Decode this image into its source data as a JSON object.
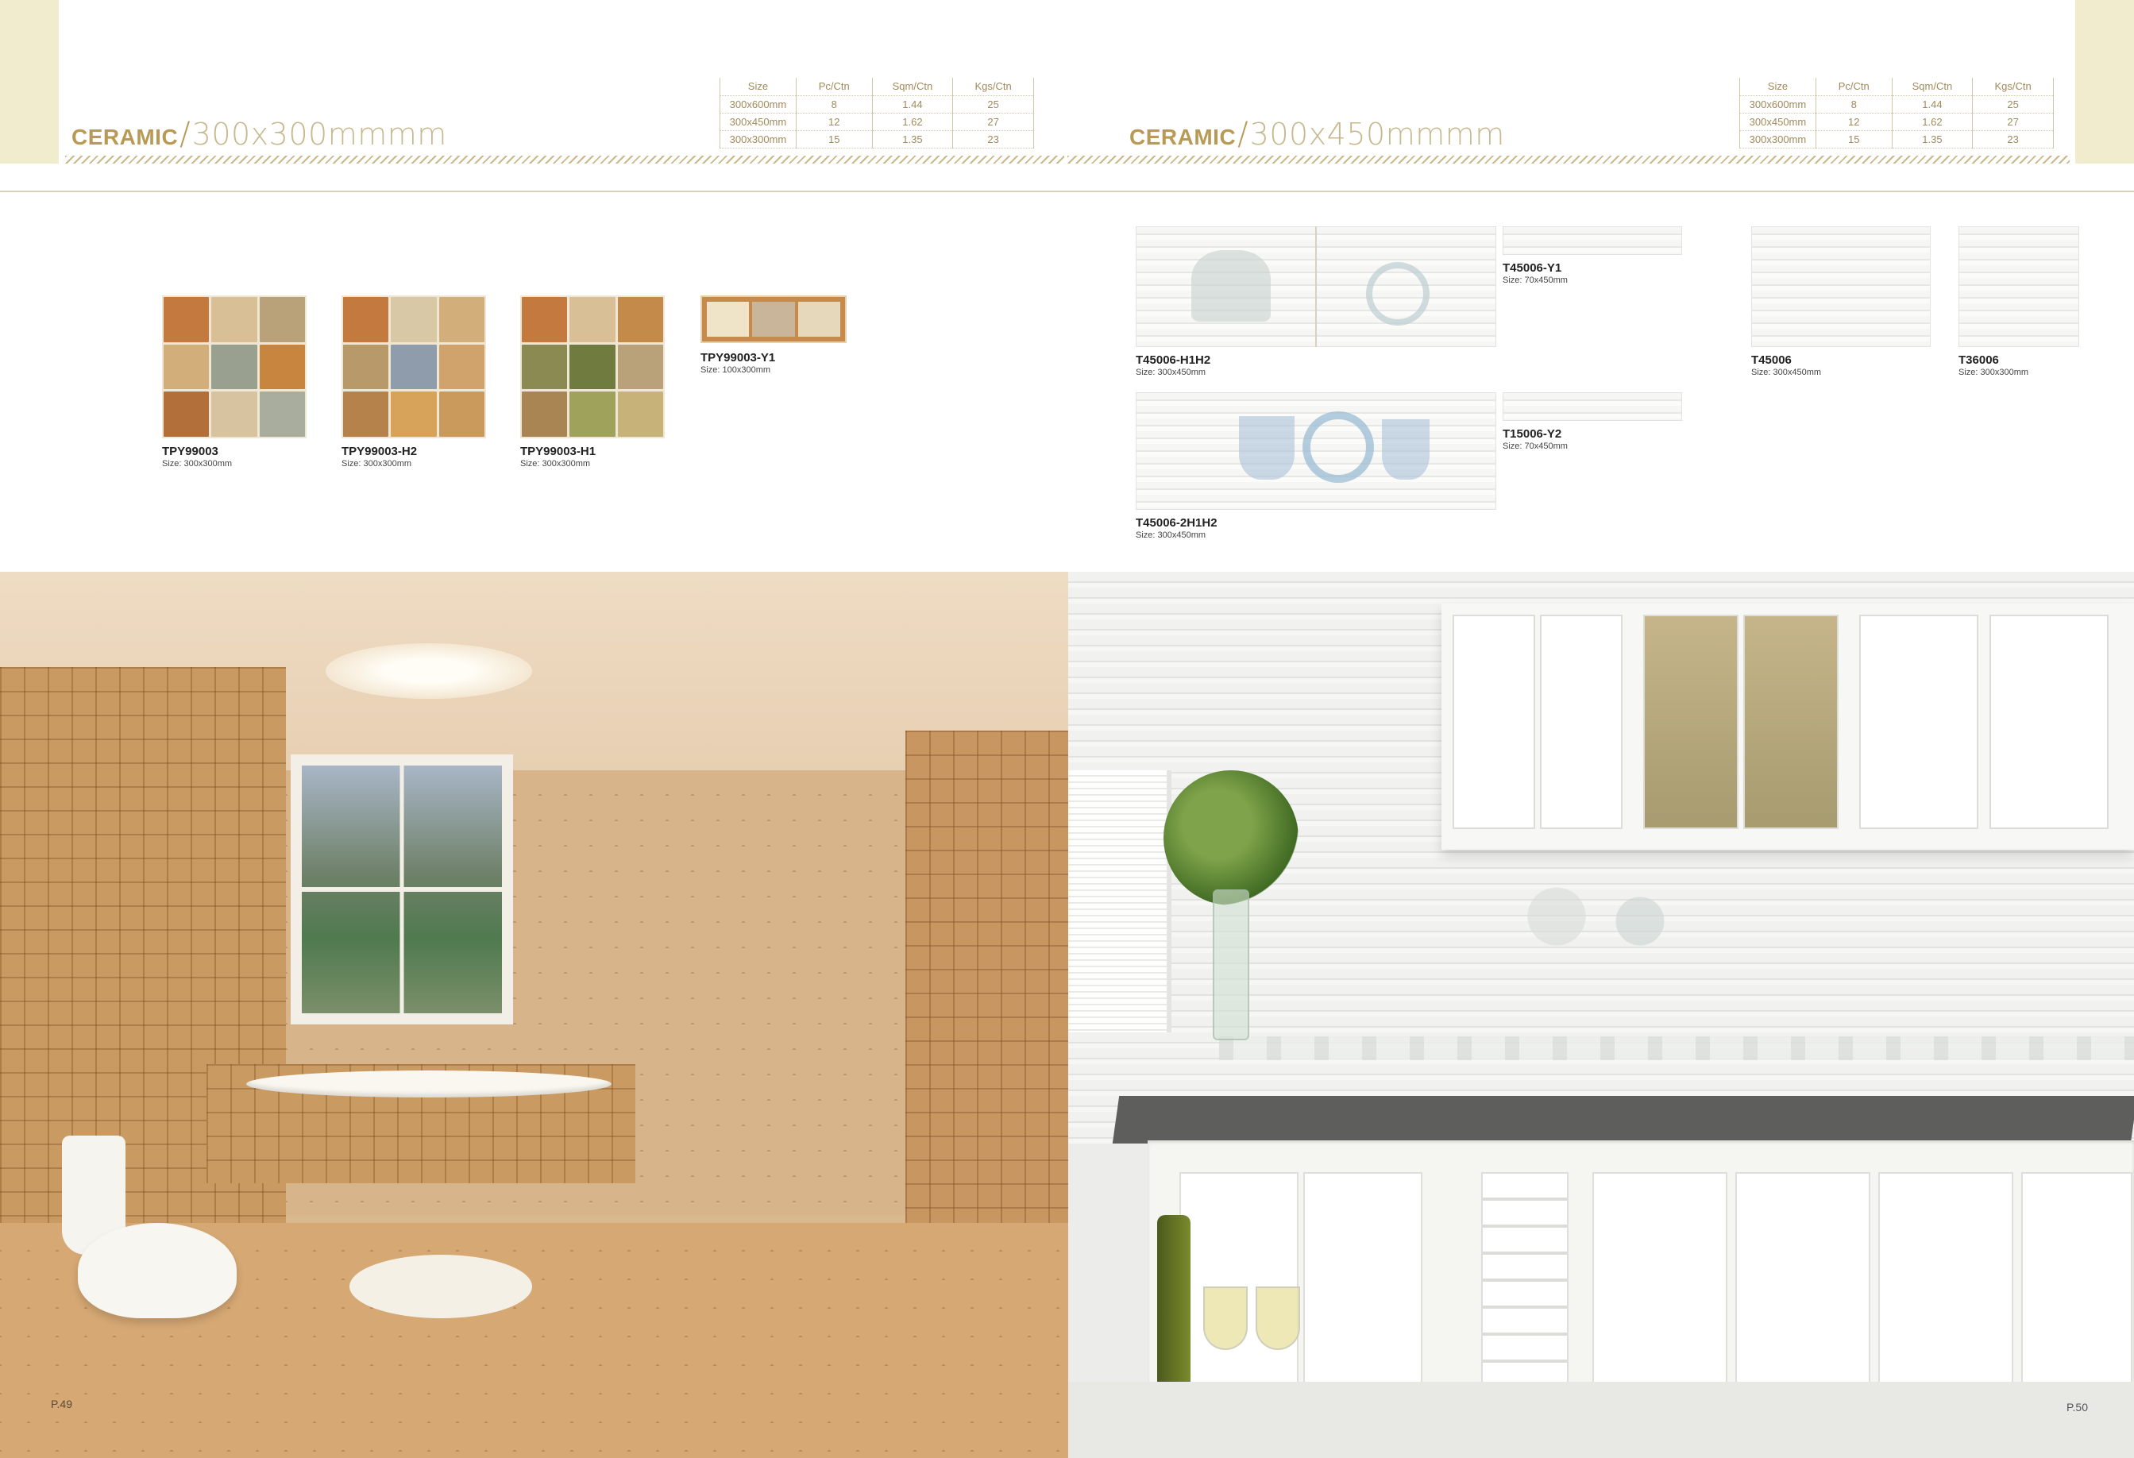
{
  "left_page": {
    "series_kind": "CERAMIC",
    "series_slash": "/",
    "series_size": "300x300mmmm",
    "spec_table": {
      "headers": [
        "Size",
        "Pc/Ctn",
        "Sqm/Ctn",
        "Kgs/Ctn"
      ],
      "rows": [
        [
          "300x600mm",
          "8",
          "1.44",
          "25"
        ],
        [
          "300x450mm",
          "12",
          "1.62",
          "27"
        ],
        [
          "300x300mm",
          "15",
          "1.35",
          "23"
        ]
      ]
    },
    "products": [
      {
        "code": "TPY99003",
        "size": "Size: 300x300mm"
      },
      {
        "code": "TPY99003-H2",
        "size": "Size: 300x300mm"
      },
      {
        "code": "TPY99003-H1",
        "size": "Size: 300x300mm"
      },
      {
        "code": "TPY99003-Y1",
        "size": "Size: 100x300mm"
      }
    ],
    "page_number": "P.49"
  },
  "right_page": {
    "series_kind": "CERAMIC",
    "series_slash": "/",
    "series_size": "300x450mmmm",
    "spec_table": {
      "headers": [
        "Size",
        "Pc/Ctn",
        "Sqm/Ctn",
        "Kgs/Ctn"
      ],
      "rows": [
        [
          "300x600mm",
          "8",
          "1.44",
          "25"
        ],
        [
          "300x450mm",
          "12",
          "1.62",
          "27"
        ],
        [
          "300x300mm",
          "15",
          "1.35",
          "23"
        ]
      ]
    },
    "products": [
      {
        "code": "T45006-H1H2",
        "size": "Size: 300x450mm"
      },
      {
        "code": "T45006-Y1",
        "size": "Size: 70x450mm"
      },
      {
        "code": "T45006-2H1H2",
        "size": "Size: 300x450mm"
      },
      {
        "code": "T15006-Y2",
        "size": "Size: 70x450mm"
      },
      {
        "code": "T45006",
        "size": "Size: 300x450mm"
      },
      {
        "code": "T36006",
        "size": "Size: 300x300mm"
      }
    ],
    "page_number": "P.50"
  },
  "colors": {
    "accent_gold": "#b89a55",
    "tab_cream": "#f1ecce",
    "text_dark": "#222222"
  }
}
